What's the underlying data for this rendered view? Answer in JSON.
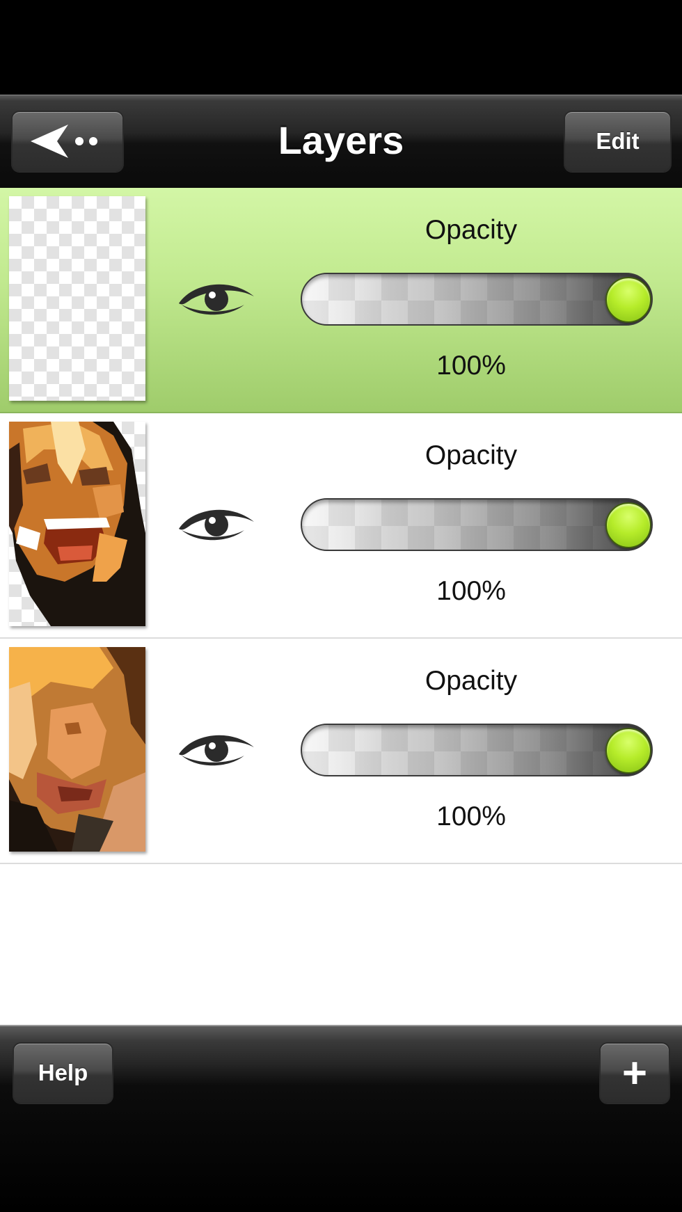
{
  "nav": {
    "title": "Layers",
    "edit_label": "Edit",
    "back_icon": "back-arrow-dots-icon"
  },
  "layers": [
    {
      "opacity_label": "Opacity",
      "opacity_text": "100%",
      "opacity_value": 1.0,
      "visible": true,
      "selected": true,
      "thumb": "empty-transparent"
    },
    {
      "opacity_label": "Opacity",
      "opacity_text": "100%",
      "opacity_value": 1.0,
      "visible": true,
      "selected": false,
      "thumb": "painted-face-partial"
    },
    {
      "opacity_label": "Opacity",
      "opacity_text": "100%",
      "opacity_value": 1.0,
      "visible": true,
      "selected": false,
      "thumb": "painted-face-full"
    }
  ],
  "toolbar": {
    "help_label": "Help",
    "add_label": "+"
  },
  "colors": {
    "selected_row": "#c2ea90",
    "knob": "#b6ec2a"
  }
}
